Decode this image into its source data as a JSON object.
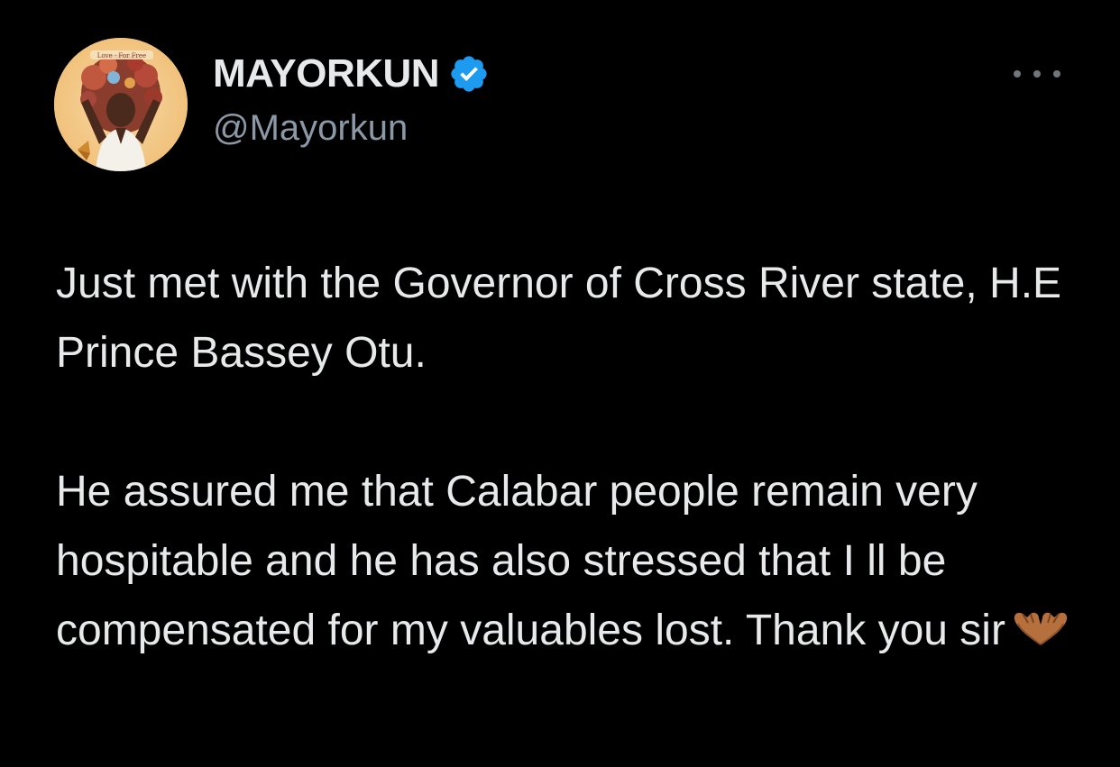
{
  "tweet": {
    "author": {
      "display_name": "MAYORKUN",
      "handle": "@Mayorkun",
      "verified": true,
      "verified_color": "#1d9bf0"
    },
    "more_icon": "ellipsis-icon",
    "paragraphs": [
      "Just met with the Governor of Cross River state, H.E Prince Bassey Otu.",
      "He assured me that Calabar people remain very hospitable and he has also stressed that I ll be compensated for my valuables lost. Thank you sir"
    ],
    "trailing_emoji": "heart-hands-icon"
  },
  "colors": {
    "background": "#000000",
    "primary_text": "#e7e9ea",
    "secondary_text": "#8b98a5"
  }
}
